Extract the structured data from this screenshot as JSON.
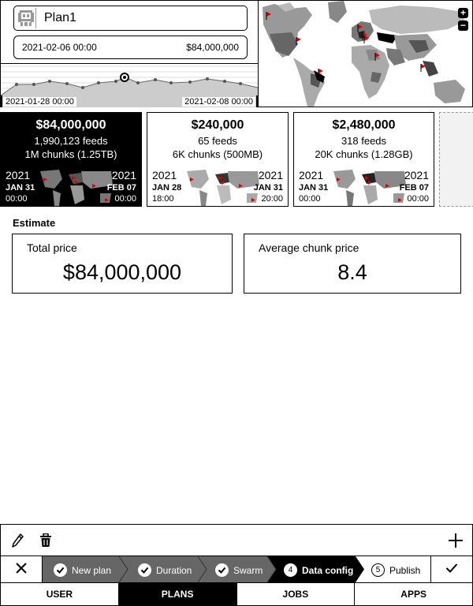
{
  "plan": {
    "name": "Plan1",
    "date_start": "2021-02-06 00:00",
    "total": "$84,000,000"
  },
  "timeline": {
    "start_label": "2021-01-28 00:00",
    "end_label": "2021-02-08 00:00"
  },
  "map": {
    "zoom_in": "+",
    "zoom_out": "−"
  },
  "cards": [
    {
      "price": "$84,000,000",
      "feeds": "1,990,123 feeds",
      "chunks": "1M chunks (1.25TB)",
      "start": {
        "year": "2021",
        "date": "JAN 31",
        "time": "00:00"
      },
      "end": {
        "year": "2021",
        "date": "FEB 07",
        "time": "00:00"
      }
    },
    {
      "price": "$240,000",
      "feeds": "65 feeds",
      "chunks": "6K chunks (500MB)",
      "start": {
        "year": "2021",
        "date": "JAN 28",
        "time": "18:00"
      },
      "end": {
        "year": "2021",
        "date": "JAN 31",
        "time": "20:00"
      }
    },
    {
      "price": "$2,480,000",
      "feeds": "318 feeds",
      "chunks": "20K chunks (1.28GB)",
      "start": {
        "year": "2021",
        "date": "JAN 31",
        "time": "00:00"
      },
      "end": {
        "year": "2021",
        "date": "FEB 07",
        "time": "00:00"
      }
    }
  ],
  "estimate": {
    "title": "Estimate",
    "total_label": "Total price",
    "total_value": "$84,000,000",
    "avg_label": "Average chunk price",
    "avg_value": "8.4"
  },
  "steps": [
    {
      "label": "New plan",
      "state": "done"
    },
    {
      "label": "Duration",
      "state": "done"
    },
    {
      "label": "Swarm",
      "state": "done"
    },
    {
      "label": "Data config",
      "state": "current",
      "number": "4"
    },
    {
      "label": "Publish",
      "state": "next",
      "number": "5"
    }
  ],
  "tabs": [
    {
      "label": "USER",
      "active": false
    },
    {
      "label": "PLANS",
      "active": true
    },
    {
      "label": "JOBS",
      "active": false
    },
    {
      "label": "APPS",
      "active": false
    }
  ],
  "icons": {
    "edit": "pencil-icon",
    "delete": "trash-icon",
    "add": "plus-icon",
    "cancel": "close-icon",
    "confirm": "check-icon"
  }
}
